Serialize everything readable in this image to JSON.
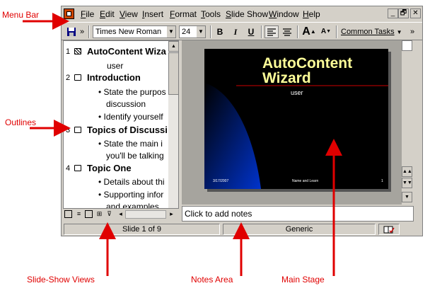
{
  "window": {
    "app_icon": "powerpoint-icon",
    "menu": [
      {
        "accel": "F",
        "rest": "ile"
      },
      {
        "accel": "E",
        "rest": "dit"
      },
      {
        "accel": "V",
        "rest": "iew"
      },
      {
        "accel": "I",
        "rest": "nsert"
      },
      {
        "accel": "F",
        "rest": "ormat",
        "plain_prefix": ""
      },
      {
        "accel": "T",
        "rest": "ools"
      },
      {
        "accel": "S",
        "rest": "lide Show",
        "plain_prefix": ""
      },
      {
        "accel": "W",
        "rest": "indow"
      },
      {
        "accel": "H",
        "rest": "elp"
      }
    ],
    "controls": {
      "minimize": "_",
      "restore": "🗗",
      "close": "✕"
    }
  },
  "toolbar": {
    "font_name": "Times New Roman",
    "font_size": "24",
    "bold": "B",
    "italic": "I",
    "underline": "U",
    "grow_font": "A",
    "shrink_font": "A",
    "common_tasks": "Common Tasks",
    "overflow": "»"
  },
  "outline": {
    "items": [
      {
        "num": "1",
        "title": "AutoContent Wiza"
      },
      {
        "sub": "user"
      },
      {
        "num": "2",
        "title": "Introduction"
      },
      {
        "bullet": "State the purpos"
      },
      {
        "bullet_cont": "discussion"
      },
      {
        "bullet": "Identify yourself"
      },
      {
        "num": "3",
        "title": "Topics of Discussi"
      },
      {
        "bullet": "State the main i"
      },
      {
        "bullet_cont": "you'll be talking"
      },
      {
        "num": "4",
        "title": "Topic One"
      },
      {
        "bullet": "Details about thi"
      },
      {
        "bullet": "Supporting infor"
      },
      {
        "bullet_cont": "and examples"
      }
    ]
  },
  "slide": {
    "title_line1": "AutoContent",
    "title_line2": "Wizard",
    "subtitle": "user",
    "footer_left": "3/17/2007",
    "footer_center": "Name and Learn",
    "footer_right": "1",
    "colors": {
      "title": "#ffff99",
      "rule": "#cc0000",
      "background": "#000000",
      "accent": "#0033cc"
    }
  },
  "notes": {
    "placeholder": "Click to add notes"
  },
  "status": {
    "slide": "Slide 1 of 9",
    "design": "Generic"
  },
  "callouts": {
    "menu_bar": "Menu Bar",
    "outlines": "Outlines",
    "views": "Slide-Show Views",
    "notes_area": "Notes Area",
    "main_stage": "Main Stage"
  }
}
